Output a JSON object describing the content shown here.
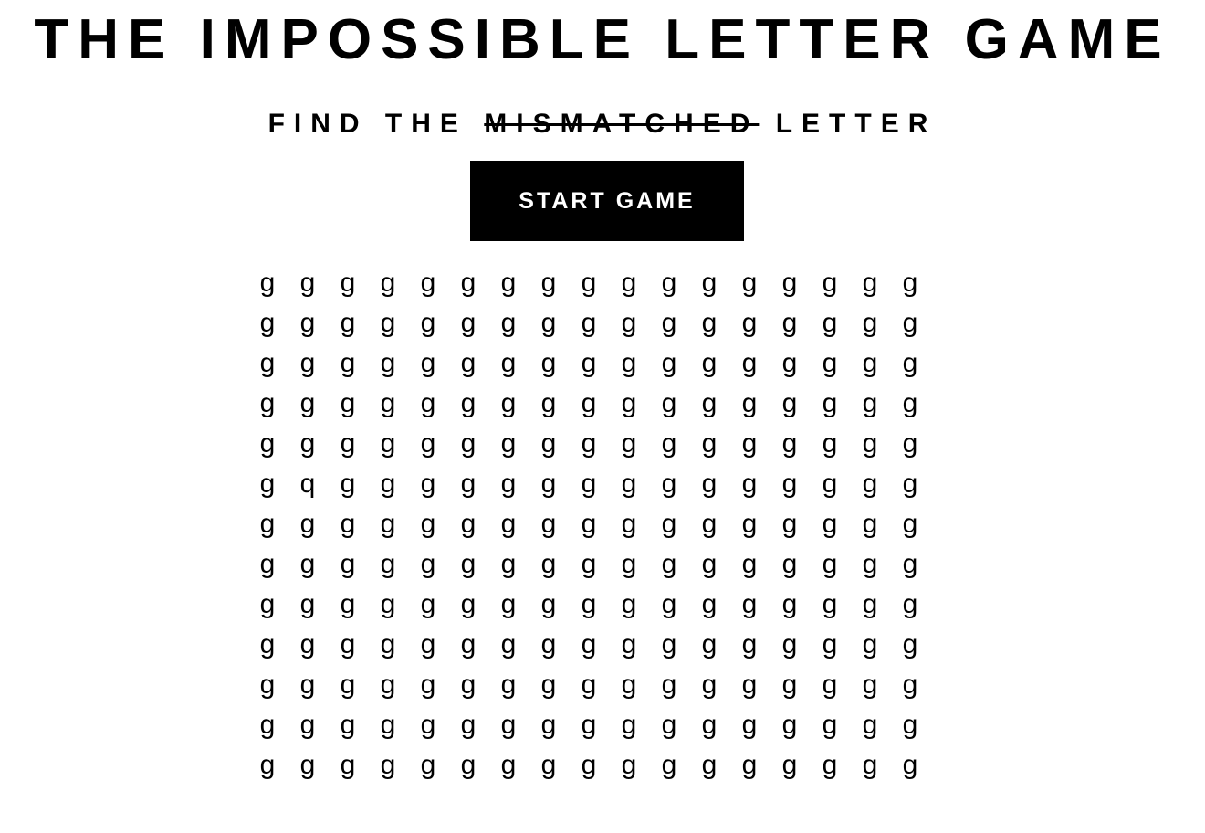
{
  "header": {
    "title": "THE IMPOSSIBLE LETTER GAME",
    "subtitle_before": "FIND THE ",
    "subtitle_strike": "MISMATCHED",
    "subtitle_after": " LETTER"
  },
  "controls": {
    "start_label": "START GAME"
  },
  "board": {
    "columns": 17,
    "rows": [
      [
        "g",
        "g",
        "g",
        "g",
        "g",
        "g",
        "g",
        "g",
        "g",
        "g",
        "g",
        "g",
        "g",
        "g",
        "g",
        "g",
        "g"
      ],
      [
        "g",
        "g",
        "g",
        "g",
        "g",
        "g",
        "g",
        "g",
        "g",
        "g",
        "g",
        "g",
        "g",
        "g",
        "g",
        "g",
        "g"
      ],
      [
        "g",
        "g",
        "g",
        "g",
        "g",
        "g",
        "g",
        "g",
        "g",
        "g",
        "g",
        "g",
        "g",
        "g",
        "g",
        "g",
        "g"
      ],
      [
        "g",
        "g",
        "g",
        "g",
        "g",
        "g",
        "g",
        "g",
        "g",
        "g",
        "g",
        "g",
        "g",
        "g",
        "g",
        "g",
        "g"
      ],
      [
        "g",
        "g",
        "g",
        "g",
        "g",
        "g",
        "g",
        "g",
        "g",
        "g",
        "g",
        "g",
        "g",
        "g",
        "g",
        "g",
        "g"
      ],
      [
        "g",
        "q",
        "g",
        "g",
        "g",
        "g",
        "g",
        "g",
        "g",
        "g",
        "g",
        "g",
        "g",
        "g",
        "g",
        "g",
        "g"
      ],
      [
        "g",
        "g",
        "g",
        "g",
        "g",
        "g",
        "g",
        "g",
        "g",
        "g",
        "g",
        "g",
        "g",
        "g",
        "g",
        "g",
        "g"
      ],
      [
        "g",
        "g",
        "g",
        "g",
        "g",
        "g",
        "g",
        "g",
        "g",
        "g",
        "g",
        "g",
        "g",
        "g",
        "g",
        "g",
        "g"
      ],
      [
        "g",
        "g",
        "g",
        "g",
        "g",
        "g",
        "g",
        "g",
        "g",
        "g",
        "g",
        "g",
        "g",
        "g",
        "g",
        "g",
        "g"
      ],
      [
        "g",
        "g",
        "g",
        "g",
        "g",
        "g",
        "g",
        "g",
        "g",
        "g",
        "g",
        "g",
        "g",
        "g",
        "g",
        "g",
        "g"
      ],
      [
        "g",
        "g",
        "g",
        "g",
        "g",
        "g",
        "g",
        "g",
        "g",
        "g",
        "g",
        "g",
        "g",
        "g",
        "g",
        "g",
        "g"
      ],
      [
        "g",
        "g",
        "g",
        "g",
        "g",
        "g",
        "g",
        "g",
        "g",
        "g",
        "g",
        "g",
        "g",
        "g",
        "g",
        "g",
        "g"
      ],
      [
        "g",
        "g",
        "g",
        "g",
        "g",
        "g",
        "g",
        "g",
        "g",
        "g",
        "g",
        "g",
        "g",
        "g",
        "g",
        "g",
        "g"
      ]
    ]
  }
}
